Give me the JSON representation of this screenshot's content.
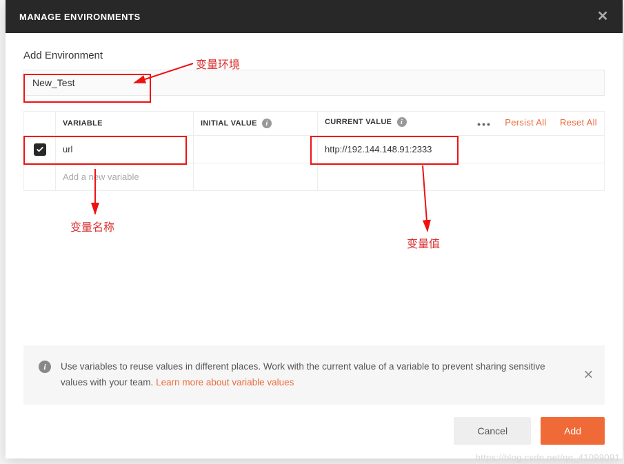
{
  "header": {
    "title": "MANAGE ENVIRONMENTS"
  },
  "section": {
    "title": "Add Environment",
    "env_name": "New_Test"
  },
  "table": {
    "headers": {
      "variable": "VARIABLE",
      "initial": "INITIAL VALUE",
      "current": "CURRENT VALUE"
    },
    "actions": {
      "more": "•••",
      "persist": "Persist All",
      "reset": "Reset All"
    },
    "rows": [
      {
        "checked": true,
        "variable": "url",
        "initial": "",
        "current": "http://192.144.148.91:2333"
      }
    ],
    "placeholder_row": {
      "variable": "Add a new variable"
    }
  },
  "help": {
    "text": "Use variables to reuse values in different places. Work with the current value of a variable to prevent sharing sensitive values with your team. ",
    "link": "Learn more about variable values"
  },
  "footer": {
    "cancel": "Cancel",
    "add": "Add"
  },
  "annotations": {
    "env": "变量环境",
    "name": "变量名称",
    "value": "变量值"
  },
  "watermark": "https://blog.csdn.net/qq_41099091"
}
